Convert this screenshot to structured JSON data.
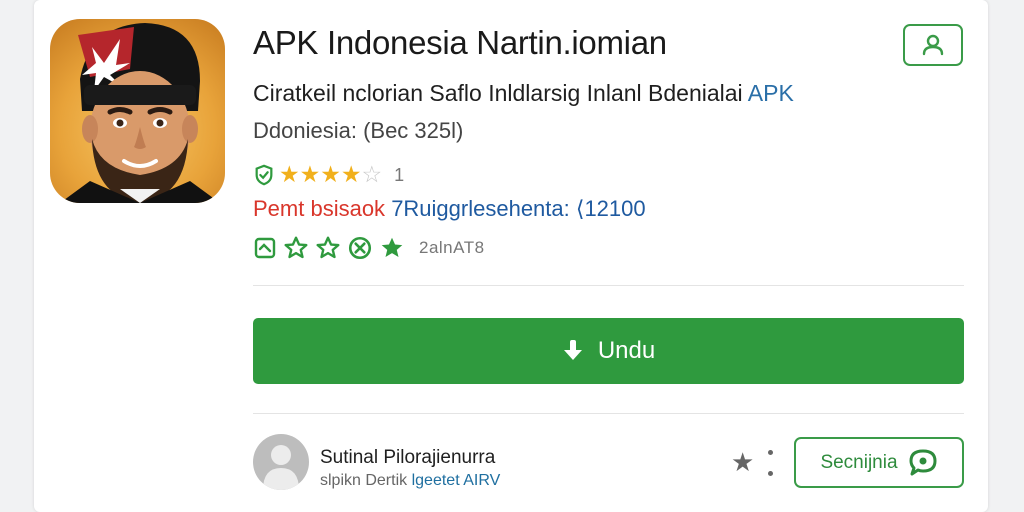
{
  "app": {
    "title": "APK Indonesia Nartin.iomian",
    "subtitle_main": "Ciratkeil nclorian Saflo Inldlarsig Inlanl Bdenialai",
    "subtitle_tag": "APK",
    "meta": "Ddoniesia: (Bec 325l)",
    "rating": {
      "filled": 4,
      "total": 5,
      "count": "1"
    },
    "info_prefix": "Pemt bsisaok",
    "info_value": "7Ruiggrlesehenta: ⟨12100",
    "badges_text": "2alnAT8"
  },
  "download": {
    "label": "Undu"
  },
  "developer": {
    "name": "Sutinal Pilorajienurra",
    "sub_prefix": "slpikn Dertik",
    "sub_highlight": "lgeetet AIRV"
  },
  "secondary_button": {
    "label": "Secnijnia"
  },
  "colors": {
    "accent_green": "#2f9a3e",
    "star_gold": "#f1b01c",
    "link_blue": "#2a6fa8",
    "warn_red": "#d9362b"
  },
  "icons": {
    "profile": "user-icon",
    "download": "download-icon",
    "favorite": "star-icon",
    "more": "more-vertical-icon",
    "chat": "chat-bubble-icon"
  }
}
